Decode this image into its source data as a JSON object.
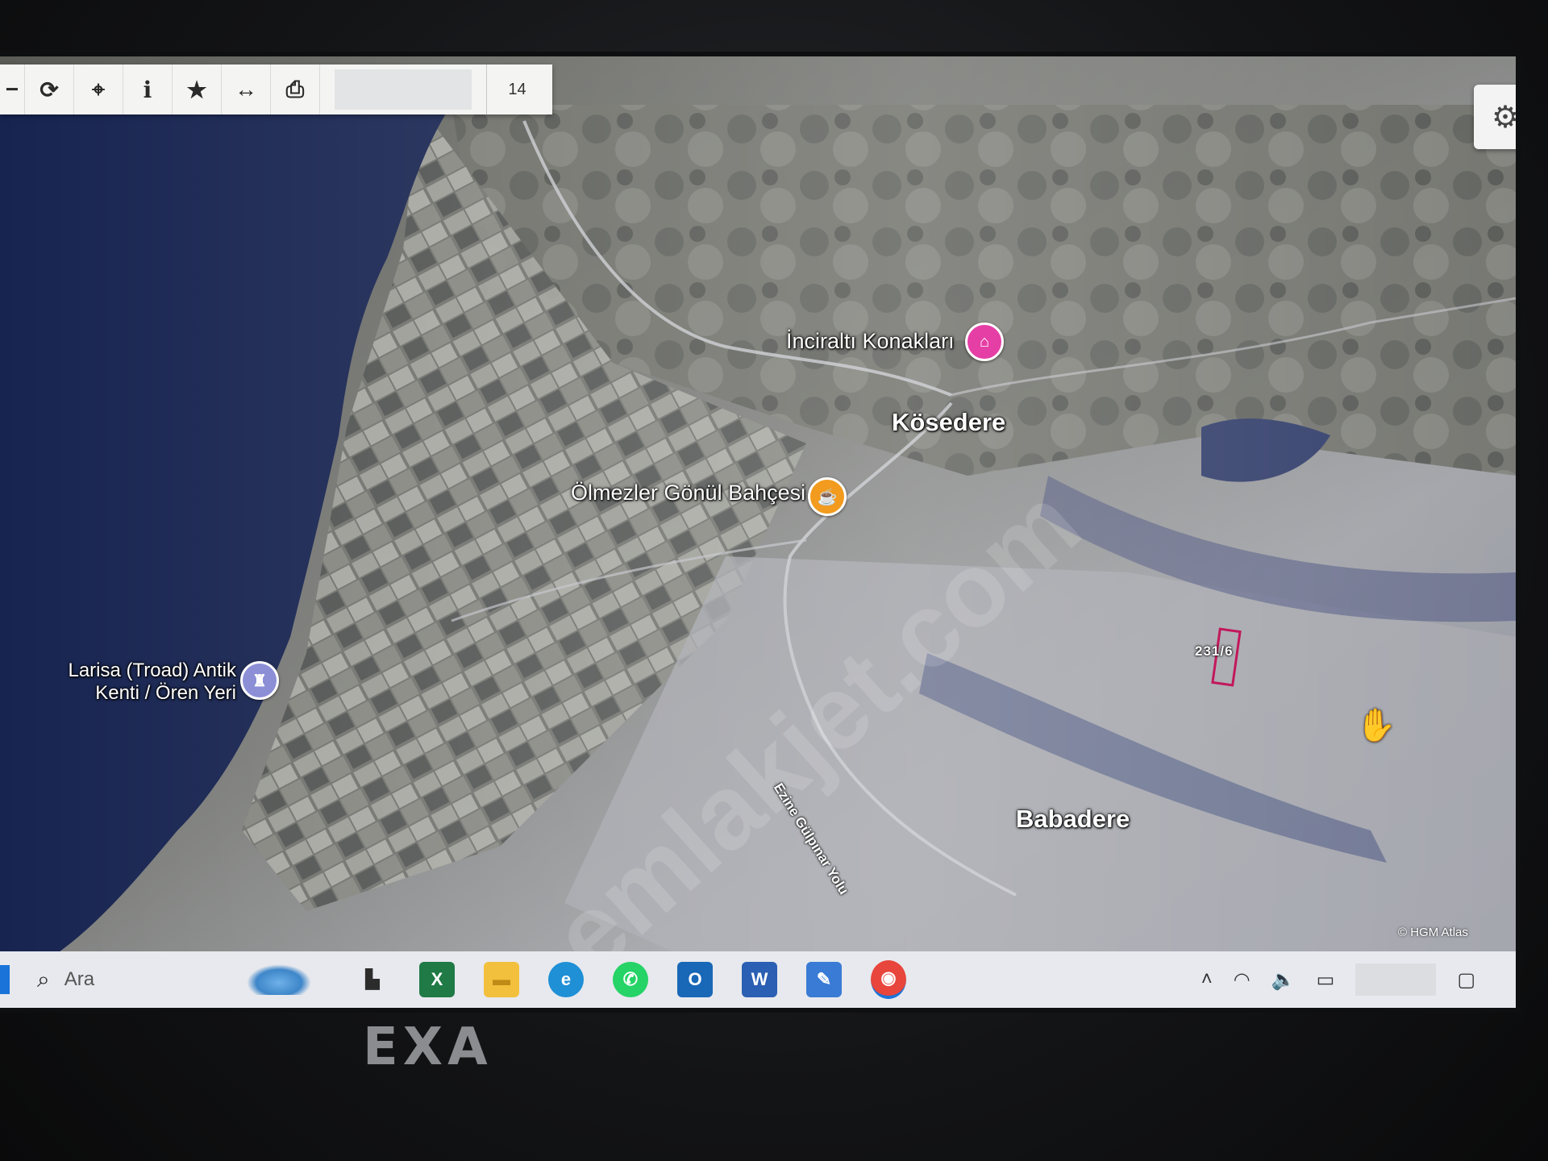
{
  "toolbar": {
    "buttons": [
      {
        "name": "minus",
        "glyph": "−"
      },
      {
        "name": "refresh",
        "glyph": "⟳"
      },
      {
        "name": "locate",
        "glyph": "⌖"
      },
      {
        "name": "info",
        "glyph": "i"
      },
      {
        "name": "favorite",
        "glyph": "★"
      },
      {
        "name": "measure",
        "glyph": "↔"
      },
      {
        "name": "print",
        "glyph": "⎙"
      }
    ],
    "zoom_level": "14"
  },
  "settings": {
    "glyph": "⚙"
  },
  "map": {
    "labels": {
      "inciralti": "İnciraltı Konakları",
      "kosedere": "Kösedere",
      "olmezler": "Ölmezler Gönül Bahçesi",
      "larisa": "Larisa (Troad) Antik Kenti / Ören Yeri",
      "babadere": "Babadere",
      "road": "Ezine Gülpınar Yolu"
    },
    "parcel_label": "231/6",
    "watermark": "emlakjet.com",
    "copyright": "© HGM Atlas",
    "colors": {
      "sea": "#1c2a5a",
      "land_dark": "#5b5e5a",
      "land_light": "#a9abb0",
      "pin_hotel": "#e53fa6",
      "pin_cafe": "#f29b1e",
      "pin_historic": "#8c8fd6",
      "parcel": "#c2185b"
    }
  },
  "taskbar": {
    "search_placeholder": "Ara",
    "apps": [
      {
        "name": "file-manager",
        "glyph": "▙",
        "color": "#2c2c2c"
      },
      {
        "name": "excel",
        "glyph": "X",
        "color": "#1f7a45"
      },
      {
        "name": "folder",
        "glyph": "▬",
        "color": "#f3c03d"
      },
      {
        "name": "edge",
        "glyph": "e",
        "color": "#1f8fd6"
      },
      {
        "name": "whatsapp",
        "glyph": "✆",
        "color": "#25d366"
      },
      {
        "name": "outlook",
        "glyph": "O",
        "color": "#1967b7"
      },
      {
        "name": "word",
        "glyph": "W",
        "color": "#2b5fb3"
      },
      {
        "name": "snipping",
        "glyph": "✎",
        "color": "#3a7bd5"
      },
      {
        "name": "chrome",
        "glyph": "◉",
        "color": "#e8453c"
      }
    ]
  },
  "device": {
    "brand": "EXA"
  }
}
